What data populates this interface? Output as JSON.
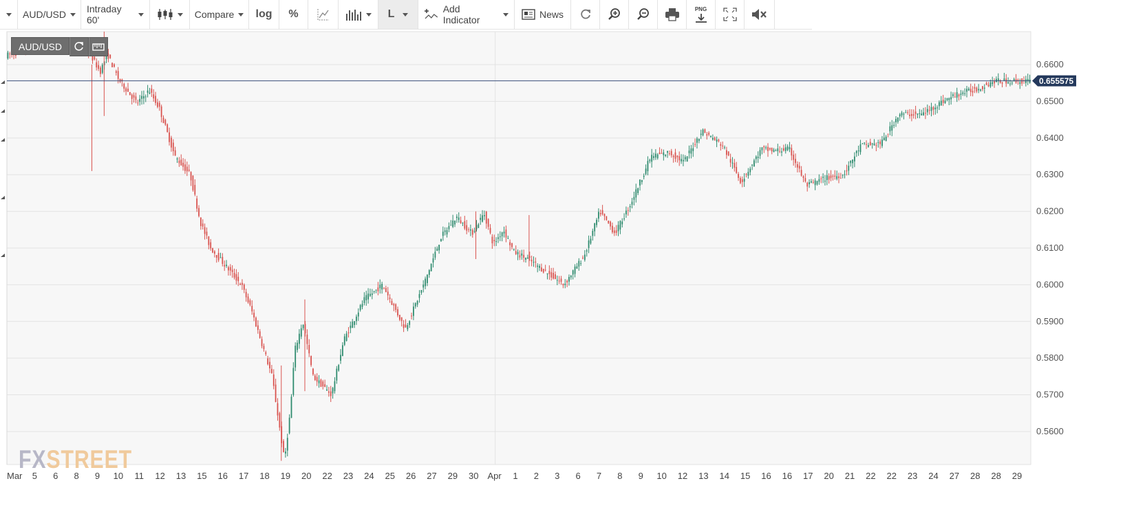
{
  "toolbar": {
    "symbol": "AUD/USD",
    "interval": "Intraday 60'",
    "compare": "Compare",
    "log": "log",
    "percent": "%",
    "style": "L",
    "add_indicator": "Add Indicator",
    "news": "News",
    "png": "PNG"
  },
  "chart_data": {
    "type": "candlestick",
    "symbol_label": "AUD/USD",
    "last_price_label": "0.655575",
    "last_price": 0.655575,
    "ylim": [
      0.551,
      0.669
    ],
    "y_ticks": [
      0.56,
      0.57,
      0.58,
      0.59,
      0.6,
      0.61,
      0.62,
      0.63,
      0.64,
      0.65,
      0.66
    ],
    "y_tick_labels": [
      "0.5600",
      "0.5700",
      "0.5800",
      "0.5900",
      "0.6000",
      "0.6100",
      "0.6200",
      "0.6300",
      "0.6400",
      "0.6500",
      "0.6600"
    ],
    "x_tick_labels": [
      "Mar",
      "5",
      "6",
      "8",
      "9",
      "10",
      "11",
      "12",
      "13",
      "15",
      "16",
      "17",
      "18",
      "19",
      "20",
      "22",
      "23",
      "24",
      "25",
      "26",
      "27",
      "29",
      "30",
      "Apr",
      "1",
      "2",
      "3",
      "6",
      "7",
      "8",
      "9",
      "10",
      "12",
      "13",
      "14",
      "15",
      "16",
      "16",
      "17",
      "20",
      "21",
      "22",
      "22",
      "23",
      "24",
      "27",
      "28",
      "28",
      "29"
    ],
    "up_color": "#2e8b6e",
    "down_color": "#d9534f",
    "path_x": [
      0,
      0.045,
      0.08,
      0.092,
      0.099,
      0.11,
      0.128,
      0.14,
      0.15,
      0.165,
      0.18,
      0.19,
      0.2,
      0.215,
      0.23,
      0.24,
      0.26,
      0.272,
      0.278,
      0.282,
      0.29,
      0.3,
      0.318,
      0.33,
      0.35,
      0.368,
      0.39,
      0.408,
      0.425,
      0.44,
      0.455,
      0.467,
      0.476,
      0.486,
      0.496,
      0.51,
      0.53,
      0.545,
      0.565,
      0.58,
      0.595,
      0.61,
      0.63,
      0.648,
      0.662,
      0.68,
      0.7,
      0.718,
      0.738,
      0.75,
      0.765,
      0.782,
      0.8,
      0.818,
      0.835,
      0.855,
      0.872,
      0.895,
      0.915,
      0.93,
      0.95,
      0.965,
      0.985,
      1.0
    ],
    "path_y": [
      0.6625,
      0.6655,
      0.664,
      0.658,
      0.663,
      0.656,
      0.6495,
      0.653,
      0.648,
      0.635,
      0.63,
      0.617,
      0.61,
      0.605,
      0.6,
      0.593,
      0.575,
      0.552,
      0.566,
      0.582,
      0.59,
      0.575,
      0.57,
      0.585,
      0.596,
      0.6,
      0.588,
      0.6,
      0.613,
      0.6185,
      0.614,
      0.6195,
      0.611,
      0.615,
      0.609,
      0.607,
      0.603,
      0.6,
      0.608,
      0.62,
      0.614,
      0.622,
      0.635,
      0.636,
      0.6335,
      0.642,
      0.638,
      0.628,
      0.637,
      0.6365,
      0.637,
      0.627,
      0.629,
      0.63,
      0.638,
      0.6385,
      0.6465,
      0.6465,
      0.65,
      0.652,
      0.6535,
      0.6555,
      0.6555,
      0.6555
    ],
    "spikes": [
      {
        "x": 0.083,
        "low": 0.631,
        "high": 0.66
      },
      {
        "x": 0.095,
        "low": 0.646,
        "high": 0.669
      },
      {
        "x": 0.268,
        "low": 0.552,
        "high": 0.578
      },
      {
        "x": 0.291,
        "low": 0.571,
        "high": 0.596
      },
      {
        "x": 0.458,
        "low": 0.607,
        "high": 0.62
      },
      {
        "x": 0.51,
        "low": 0.605,
        "high": 0.619
      }
    ]
  }
}
